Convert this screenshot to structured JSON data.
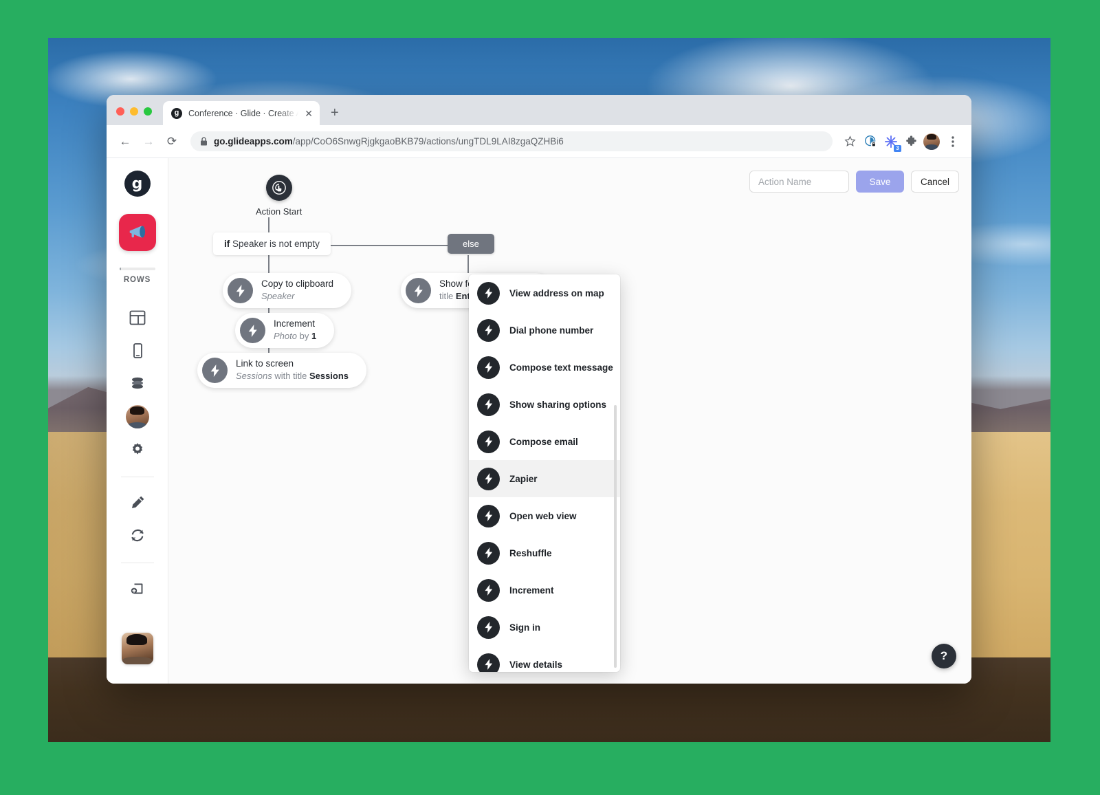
{
  "browser": {
    "tab": {
      "title": "Conference · Glide · Create App",
      "favicon": "glide-logo-icon",
      "close": "✕"
    },
    "new_tab": "+",
    "nav": {
      "back": "←",
      "forward": "→",
      "reload": "⟳"
    },
    "url": {
      "lock": "🔒",
      "domain": "go.glideapps.com",
      "path": "/app/CoO6SnwgRjgkgaoBKB79/actions/ungTDL9LAI8zgaQZHBi6"
    },
    "toolbar_icons": [
      "bookmark-star-icon",
      "privacy-badger-icon",
      "extension-sparkle-icon",
      "puzzle-extensions-icon",
      "profile-avatar-icon"
    ],
    "extension_badge": "3"
  },
  "sidebar": {
    "logo": "g",
    "app_icon": "megaphone-icon",
    "rows": {
      "label": "ROWS",
      "fill_percent": 5
    },
    "items": [
      {
        "name": "layout-icon"
      },
      {
        "name": "device-preview-icon"
      },
      {
        "name": "data-stack-icon"
      },
      {
        "name": "user-avatar-icon"
      },
      {
        "name": "settings-gear-icon"
      },
      {
        "name": "pencil-edit-icon"
      },
      {
        "name": "refresh-sync-icon"
      },
      {
        "name": "add-screen-icon"
      }
    ],
    "account_avatar": "account-avatar-icon"
  },
  "topbar": {
    "action_name_placeholder": "Action Name",
    "action_name_value": "",
    "save_label": "Save",
    "cancel_label": "Cancel"
  },
  "flow": {
    "start_label": "Action Start",
    "condition": {
      "keyword": "if",
      "text": "Speaker is not empty"
    },
    "else_label": "else",
    "nodes": [
      {
        "title": "Copy to clipboard",
        "sub_italic": "Speaker",
        "sub_plain": "",
        "sub_bold": ""
      },
      {
        "title": "Increment",
        "sub_italic": "Photo",
        "sub_plain": " by ",
        "sub_bold": "1"
      },
      {
        "title": "Link to screen",
        "sub_italic": "Sessions",
        "sub_plain": " with title ",
        "sub_bold": "Sessions"
      },
      {
        "title": "Show form",
        "sub_italic": "",
        "sub_plain": "title ",
        "sub_bold": "Enter Speaker Info"
      }
    ]
  },
  "dropdown": {
    "items": [
      {
        "label": "View address on map",
        "active": false
      },
      {
        "label": "Dial phone number",
        "active": false
      },
      {
        "label": "Compose text message",
        "active": false
      },
      {
        "label": "Show sharing options",
        "active": false
      },
      {
        "label": "Compose email",
        "active": false
      },
      {
        "label": "Zapier",
        "active": true
      },
      {
        "label": "Open web view",
        "active": false
      },
      {
        "label": "Reshuffle",
        "active": false
      },
      {
        "label": "Increment",
        "active": false
      },
      {
        "label": "Sign in",
        "active": false
      },
      {
        "label": "View details",
        "active": false
      }
    ]
  },
  "help": {
    "label": "?"
  },
  "colors": {
    "accent_save": "#9ba4ec",
    "app_icon_bg": "#e8274b",
    "node_bolt": "#70755f",
    "dropdown_bolt": "#23272c",
    "desktop_bg": "#27ae60"
  }
}
